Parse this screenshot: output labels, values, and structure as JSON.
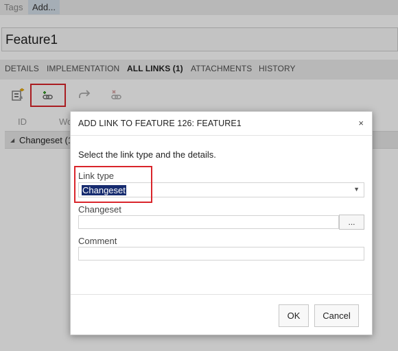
{
  "tags": {
    "label": "Tags",
    "add_label": "Add..."
  },
  "work_item": {
    "title": "Feature1"
  },
  "tabs": [
    {
      "label": "DETAILS",
      "active": false
    },
    {
      "label": "IMPLEMENTATION",
      "active": false
    },
    {
      "label": "ALL LINKS (1)",
      "active": true
    },
    {
      "label": "ATTACHMENTS",
      "active": false
    },
    {
      "label": "HISTORY",
      "active": false
    }
  ],
  "toolbar": {
    "icons": [
      "new-linked-item-icon",
      "add-link-icon",
      "open-link-icon",
      "delete-link-icon"
    ]
  },
  "grid": {
    "columns": [
      "ID",
      "Wo"
    ],
    "group_label": "Changeset (1"
  },
  "dialog": {
    "title": "ADD LINK TO FEATURE 126: FEATURE1",
    "close_glyph": "×",
    "description": "Select the link type and the details.",
    "link_type_label": "Link type",
    "link_type_value": "Changeset",
    "changeset_label": "Changeset",
    "changeset_value": "",
    "browse_label": "...",
    "comment_label": "Comment",
    "comment_value": "",
    "ok_label": "OK",
    "cancel_label": "Cancel"
  },
  "colors": {
    "highlight": "#d9242a",
    "selection": "#172c6f",
    "add_icon_green": "#3c9b2d"
  }
}
